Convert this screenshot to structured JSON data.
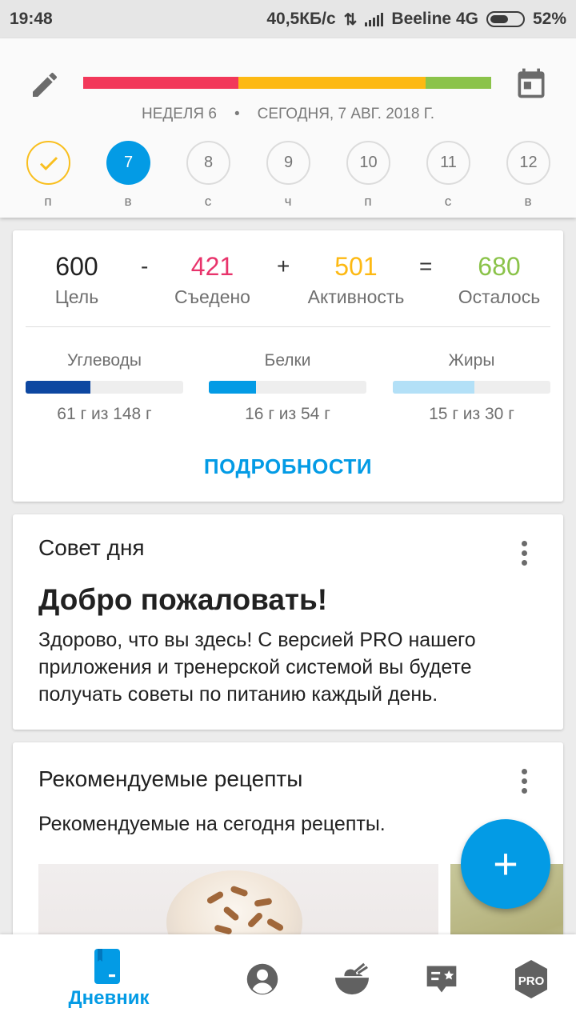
{
  "status_bar": {
    "time": "19:48",
    "speed": "40,5КБ/с",
    "carrier": "Beeline 4G",
    "battery": "52%"
  },
  "header": {
    "week": "НЕДЕЛЯ 6",
    "separator": "•",
    "date": "СЕГОДНЯ, 7 АВГ. 2018 Г.",
    "progress_colors": [
      "#f2385a",
      "#fdb913",
      "#8bc34a"
    ],
    "days": [
      {
        "number": "",
        "label": "п",
        "state": "done"
      },
      {
        "number": "7",
        "label": "в",
        "state": "active"
      },
      {
        "number": "8",
        "label": "с",
        "state": "normal"
      },
      {
        "number": "9",
        "label": "ч",
        "state": "normal"
      },
      {
        "number": "10",
        "label": "п",
        "state": "normal"
      },
      {
        "number": "11",
        "label": "с",
        "state": "normal"
      },
      {
        "number": "12",
        "label": "в",
        "state": "normal"
      }
    ]
  },
  "summary": {
    "goal": {
      "value": "600",
      "label": "Цель"
    },
    "minus": "-",
    "eaten": {
      "value": "421",
      "label": "Съедено"
    },
    "plus": "+",
    "activity": {
      "value": "501",
      "label": "Активность"
    },
    "equals": "=",
    "remaining": {
      "value": "680",
      "label": "Осталось"
    },
    "colors": {
      "eaten": "#e8336b",
      "activity": "#fdb913",
      "remaining": "#8bc34a"
    },
    "macros": [
      {
        "name": "Углеводы",
        "value": "61 г из 148 г",
        "fraction": 0.41,
        "color": "#0d47a1"
      },
      {
        "name": "Белки",
        "value": "16 г из 54 г",
        "fraction": 0.3,
        "color": "#039be5"
      },
      {
        "name": "Жиры",
        "value": "15 г из 30 г",
        "fraction": 0.52,
        "color": "#b3e0f7"
      }
    ],
    "details_button": "ПОДРОБНОСТИ"
  },
  "tip": {
    "title": "Совет дня",
    "headline": "Добро пожаловать!",
    "body": "Здорово, что вы здесь! С версией PRO нашего приложения и тренерской системой вы будете получать советы по питанию каждый день."
  },
  "recipes": {
    "title": "Рекомендуемые рецепты",
    "subtitle": "Рекомендуемые на сегодня рецепты."
  },
  "fab": {
    "icon": "plus-icon",
    "label": "+"
  },
  "bottom_nav": {
    "items": [
      {
        "icon": "diary-icon",
        "label": "Дневник",
        "active": true
      },
      {
        "icon": "profile-icon",
        "label": "",
        "active": false
      },
      {
        "icon": "recipes-bowl-icon",
        "label": "",
        "active": false
      },
      {
        "icon": "plans-icon",
        "label": "",
        "active": false
      },
      {
        "icon": "pro-badge-icon",
        "label": "PRO",
        "active": false
      }
    ]
  }
}
